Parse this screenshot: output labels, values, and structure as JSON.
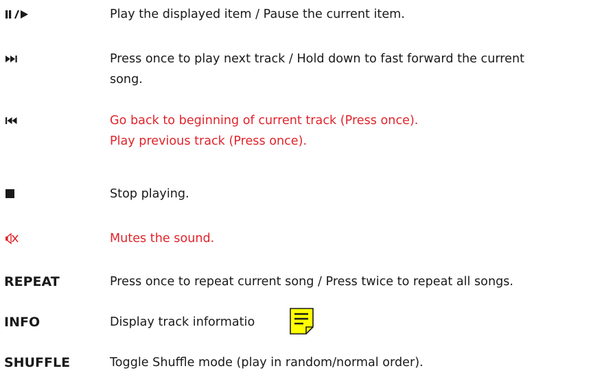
{
  "rows": [
    {
      "key_icon": "play-pause-icon",
      "desc_lines": [
        "Play the displayed item / Pause the current item."
      ],
      "color": "#1a1a1a"
    },
    {
      "key_icon": "next-track-icon",
      "desc_lines": [
        "Press once to play next track / Hold down to fast forward the current",
        "song."
      ],
      "color": "#1a1a1a"
    },
    {
      "key_icon": "previous-track-icon",
      "desc_lines": [
        "Go back to beginning of current track (Press once).",
        "Play previous track  (Press once)."
      ],
      "color": "#e0242b"
    },
    {
      "key_icon": "stop-icon",
      "desc_lines": [
        "Stop playing."
      ],
      "color": "#1a1a1a"
    },
    {
      "key_icon": "mute-icon",
      "desc_lines": [
        "Mutes the sound."
      ],
      "color": "#e0242b"
    },
    {
      "key_label": "REPEAT",
      "desc_lines": [
        "Press once to repeat current song / Press twice to repeat all songs."
      ],
      "color": "#1a1a1a"
    },
    {
      "key_label": "INFO",
      "desc_lines": [
        "Display track informatio"
      ],
      "color": "#1a1a1a",
      "annotation_icon": "sticky-note-icon"
    },
    {
      "key_label": "SHUFFLE",
      "desc_lines": [
        "Toggle Shuffle mode (play in random/normal order)."
      ],
      "color": "#1a1a1a"
    }
  ],
  "colors": {
    "text": "#1a1a1a",
    "accent_red": "#e0242b",
    "note_yellow": "#ffff00"
  }
}
